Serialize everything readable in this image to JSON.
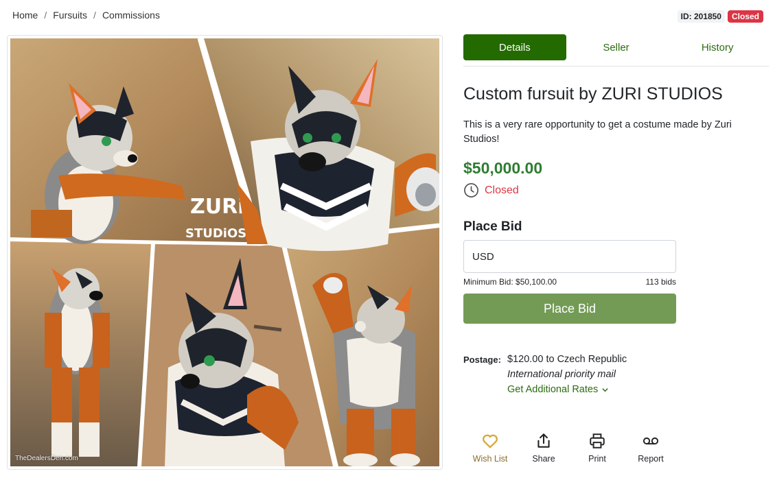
{
  "breadcrumb": {
    "items": [
      "Home",
      "Fursuits",
      "Commissions"
    ],
    "separator": "/"
  },
  "listing": {
    "id_label": "ID: 201850",
    "status_badge": "Closed"
  },
  "image": {
    "watermark": "TheDealersDen.com",
    "logo_text": [
      "ZURi",
      "STUDiOS"
    ]
  },
  "tabs": [
    {
      "label": "Details",
      "active": true
    },
    {
      "label": "Seller",
      "active": false
    },
    {
      "label": "History",
      "active": false
    }
  ],
  "details": {
    "title": "Custom fursuit by ZURI STUDIOS",
    "description": "This is a very rare opportunity to get a costume made by Zuri Studios!",
    "price": "$50,000.00",
    "status": "Closed",
    "status_icon": "clock-icon"
  },
  "bid": {
    "heading": "Place Bid",
    "input_value": "USD",
    "minimum": "Minimum Bid: $50,100.00",
    "count": "113 bids",
    "button": "Place Bid"
  },
  "postage": {
    "label": "Postage:",
    "cost": "$120.00 to Czech Republic",
    "method": "International priority mail",
    "rates_link": "Get Additional Rates"
  },
  "actions": [
    {
      "label": "Wish List",
      "icon": "heart-icon"
    },
    {
      "label": "Share",
      "icon": "share-icon"
    },
    {
      "label": "Print",
      "icon": "printer-icon"
    },
    {
      "label": "Report",
      "icon": "voicemail-icon"
    }
  ],
  "colors": {
    "accent_green": "#236a01",
    "price_green": "#2e7d32",
    "bid_button": "#739b56",
    "closed_red": "#dc3545",
    "heart_gold": "#d9a93c"
  }
}
